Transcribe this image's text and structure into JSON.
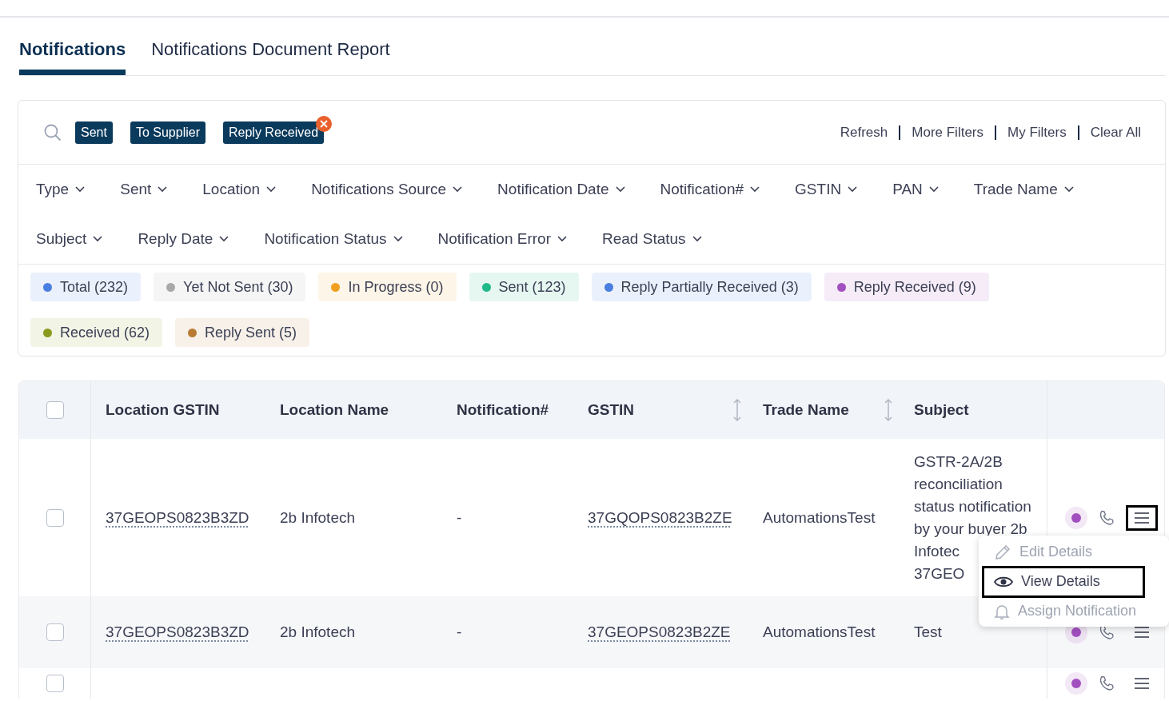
{
  "tabs": [
    {
      "label": "Notifications",
      "selected": true
    },
    {
      "label": "Notifications Document Report",
      "selected": false
    }
  ],
  "active_filters": [
    {
      "label": "Sent",
      "removable": false
    },
    {
      "label": "To Supplier",
      "removable": false
    },
    {
      "label": "Reply Received",
      "removable": true
    }
  ],
  "toolbar_links": [
    "Refresh",
    "More Filters",
    "My Filters",
    "Clear All"
  ],
  "filter_rows": [
    [
      "Type",
      "Sent",
      "Location",
      "Notifications Source",
      "Notification Date",
      "Notification#",
      "GSTIN",
      "PAN",
      "Trade Name"
    ],
    [
      "Subject",
      "Reply Date",
      "Notification Status",
      "Notification Error",
      "Read Status"
    ]
  ],
  "status_pills": [
    {
      "label": "Total (232)",
      "color": "#4a7fe0"
    },
    {
      "label": "Yet Not Sent (30)",
      "color": "#a8a8a8"
    },
    {
      "label": "In Progress (0)",
      "color": "#f0a020"
    },
    {
      "label": "Sent (123)",
      "color": "#1fb98a"
    },
    {
      "label": "Reply Partially Received (3)",
      "color": "#4a7fe0"
    },
    {
      "label": "Reply Received (9)",
      "color": "#a24fbf"
    },
    {
      "label": "Received (62)",
      "color": "#8a9a1e"
    },
    {
      "label": "Reply Sent (5)",
      "color": "#b97b33"
    }
  ],
  "table": {
    "header_checked": false,
    "columns": [
      {
        "label": "Location GSTIN",
        "sortable": false
      },
      {
        "label": "Location Name",
        "sortable": false
      },
      {
        "label": "Notification#",
        "sortable": false
      },
      {
        "label": "GSTIN",
        "sortable": true
      },
      {
        "label": "Trade Name",
        "sortable": true
      },
      {
        "label": "Subject",
        "sortable": false
      }
    ],
    "rows": [
      {
        "checked": false,
        "location_gstin": "37GEOPS0823B3ZD",
        "location_name": "2b Infotech",
        "notification_no": "-",
        "gstin": "37GQOPS0823B2ZE",
        "trade_name": "AutomationsTest",
        "subject_lines": [
          "GSTR-2A/2B",
          "reconciliation",
          "status notification",
          "by your buyer 2b",
          "Infotec",
          "37GEO"
        ],
        "menu_open": true
      },
      {
        "checked": false,
        "location_gstin": "37GEOPS0823B3ZD",
        "location_name": "2b Infotech",
        "notification_no": "-",
        "gstin": "37GEOPS0823B2ZE",
        "trade_name": "AutomationsTest",
        "subject_lines": [
          "Test"
        ],
        "menu_open": false
      },
      {
        "checked": false,
        "menu_open": false
      }
    ],
    "row_menu": [
      {
        "label": "Edit Details",
        "disabled": true,
        "selected": false
      },
      {
        "label": "View Details",
        "disabled": false,
        "selected": true
      },
      {
        "label": "Assign Notification",
        "disabled": true,
        "selected": false
      }
    ]
  }
}
